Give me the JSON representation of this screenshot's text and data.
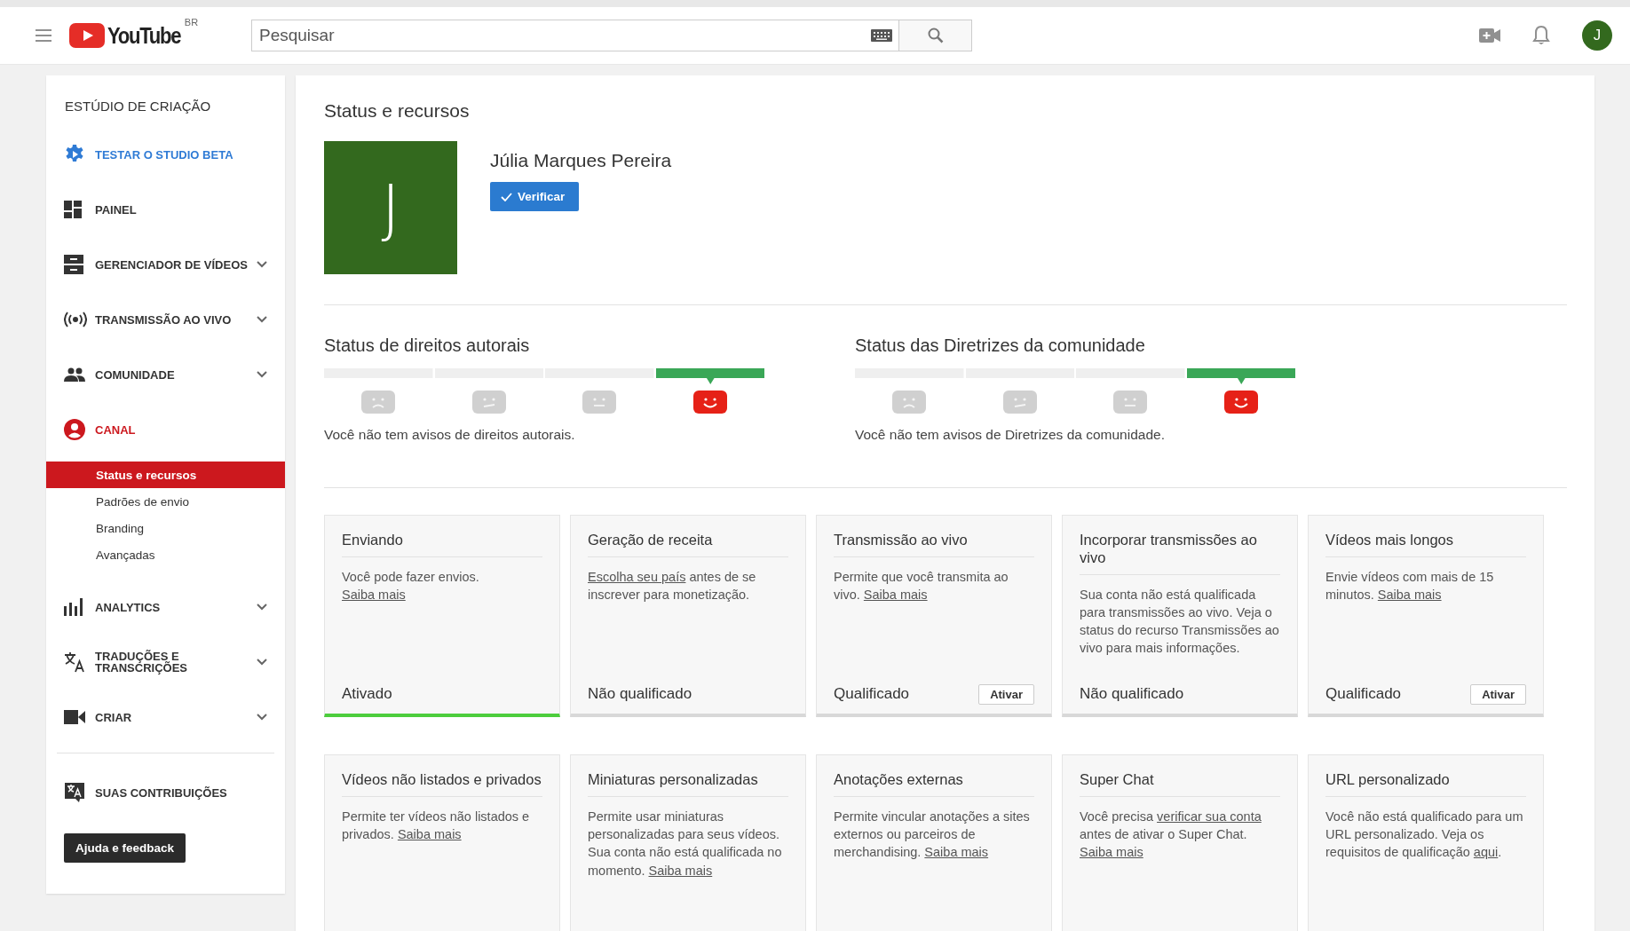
{
  "topbar": {
    "logo": "YouTube",
    "region": "BR",
    "search": {
      "placeholder": "Pesquisar"
    },
    "avatar": "J"
  },
  "sidebar": {
    "title": "ESTÚDIO DE CRIAÇÃO",
    "items": [
      {
        "kind": "beta",
        "label": "TESTAR O STUDIO BETA",
        "promo": true,
        "selected": false,
        "expandable": false
      },
      {
        "kind": "dashboard",
        "label": "PAINEL",
        "promo": false,
        "selected": false,
        "expandable": false
      },
      {
        "kind": "videos",
        "label": "GERENCIADOR DE VÍDEOS",
        "promo": false,
        "selected": false,
        "expandable": true
      },
      {
        "kind": "live",
        "label": "TRANSMISSÃO AO VIVO",
        "promo": false,
        "selected": false,
        "expandable": true
      },
      {
        "kind": "people",
        "label": "COMUNIDADE",
        "promo": false,
        "selected": false,
        "expandable": true
      },
      {
        "kind": "account",
        "label": "CANAL",
        "promo": false,
        "selected": true,
        "expandable": false,
        "children": [
          {
            "label": "Status e recursos",
            "selected": true
          },
          {
            "label": "Padrões de envio",
            "selected": false
          },
          {
            "label": "Branding",
            "selected": false
          },
          {
            "label": "Avançadas",
            "selected": false
          }
        ]
      },
      {
        "kind": "analytics",
        "label": "ANALYTICS",
        "promo": false,
        "selected": false,
        "expandable": true
      },
      {
        "kind": "translate",
        "label": "TRADUÇÕES E TRANSCRIÇÕES",
        "promo": false,
        "selected": false,
        "expandable": true
      },
      {
        "kind": "camera",
        "label": "CRIAR",
        "promo": false,
        "selected": false,
        "expandable": true
      },
      {
        "kind": "contrib",
        "label": "SUAS CONTRIBUIÇÕES",
        "promo": false,
        "selected": false,
        "expandable": false,
        "divider_before": true
      }
    ],
    "help_button": "Ajuda e feedback"
  },
  "main": {
    "title": "Status e recursos",
    "channel": {
      "initial": "J",
      "name": "Júlia Marques Pereira",
      "verify_button": "Verificar"
    },
    "statuses": [
      {
        "title": "Status de direitos autorais",
        "segments": [
          {
            "kind": "sad",
            "selected": false
          },
          {
            "kind": "smirk",
            "selected": false
          },
          {
            "kind": "neutral",
            "selected": false
          },
          {
            "kind": "happy",
            "selected": true
          }
        ],
        "message": "Você não tem avisos de direitos autorais."
      },
      {
        "title": "Status das Diretrizes da comunidade",
        "segments": [
          {
            "kind": "sad",
            "selected": false
          },
          {
            "kind": "smirk",
            "selected": false
          },
          {
            "kind": "neutral",
            "selected": false
          },
          {
            "kind": "happy",
            "selected": true
          }
        ],
        "message": "Você não tem avisos de Diretrizes da comunidade."
      }
    ],
    "features": [
      {
        "title": "Enviando",
        "description": [
          {
            "text": "Você pode fazer envios. "
          },
          {
            "text": "Saiba mais",
            "link": true
          }
        ],
        "status": "Ativado",
        "enabled": true
      },
      {
        "title": "Geração de receita",
        "description": [
          {
            "text": "Escolha seu país",
            "link": true
          },
          {
            "text": " antes de se inscrever para monetização."
          }
        ],
        "status": "Não qualificado",
        "enabled": false
      },
      {
        "title": "Transmissão ao vivo",
        "description": [
          {
            "text": "Permite que você transmita ao vivo. "
          },
          {
            "text": "Saiba mais",
            "link": true
          }
        ],
        "status": "Qualificado",
        "button": "Ativar",
        "enabled": false
      },
      {
        "title": "Incorporar transmissões ao vivo",
        "description": [
          {
            "text": "Sua conta não está qualificada para transmissões ao vivo. Veja o status do recurso Transmissões ao vivo para mais informações."
          }
        ],
        "status": "Não qualificado",
        "enabled": false
      },
      {
        "title": "Vídeos mais longos",
        "description": [
          {
            "text": "Envie vídeos com mais de 15 minutos. "
          },
          {
            "text": "Saiba mais",
            "link": true
          }
        ],
        "status": "Qualificado",
        "button": "Ativar",
        "enabled": false
      },
      {
        "title": "Vídeos não listados e privados",
        "description": [
          {
            "text": "Permite ter vídeos não listados e privados. "
          },
          {
            "text": "Saiba mais",
            "link": true
          }
        ]
      },
      {
        "title": "Miniaturas personalizadas",
        "description": [
          {
            "text": "Permite usar miniaturas personalizadas para seus vídeos. Sua conta não está qualificada no momento. "
          },
          {
            "text": "Saiba mais",
            "link": true
          }
        ]
      },
      {
        "title": "Anotações externas",
        "description": [
          {
            "text": "Permite vincular anotações a sites externos ou parceiros de merchandising. "
          },
          {
            "text": "Saiba mais",
            "link": true
          }
        ]
      },
      {
        "title": "Super Chat",
        "description": [
          {
            "text": "Você precisa "
          },
          {
            "text": "verificar sua conta",
            "link": true
          },
          {
            "text": " antes de ativar o Super Chat. "
          },
          {
            "text": "Saiba mais",
            "link": true
          }
        ]
      },
      {
        "title": "URL personalizado",
        "description": [
          {
            "text": "Você não está qualificado para um URL personalizado. Veja os requisitos de qualificação "
          },
          {
            "text": "aqui",
            "link": true
          },
          {
            "text": "."
          }
        ]
      }
    ]
  }
}
